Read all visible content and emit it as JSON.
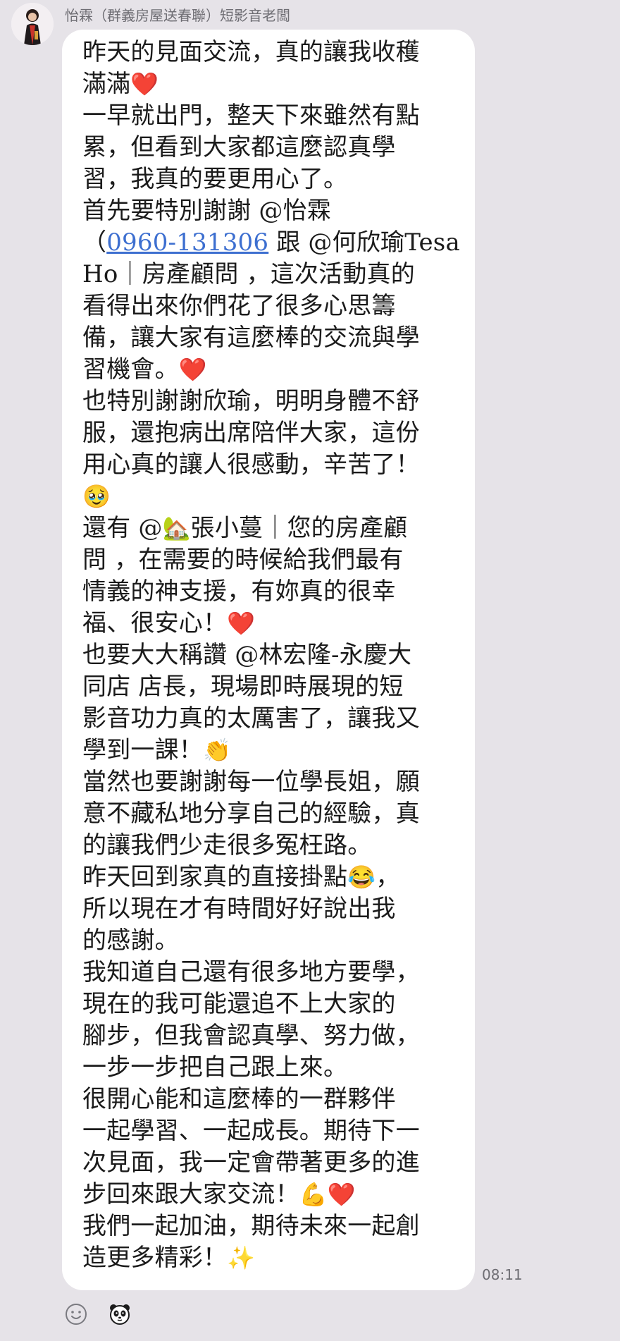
{
  "sender": {
    "name": "怡霖（群義房屋送春聯）短影音老闆"
  },
  "message": {
    "lines": [
      [
        "昨天的見面交流，真的讓我收穫"
      ],
      [
        "滿滿",
        "❤️"
      ],
      [
        "一早就出門，整天下來雖然有點"
      ],
      [
        "累，但看到大家都這麼認真學"
      ],
      [
        "習，我真的要更用心了。"
      ],
      [
        "首先要特別謝謝 @怡霖"
      ],
      [
        "（",
        "0960-131306",
        " 跟 @何欣瑜Tesa"
      ],
      [
        "Ho｜房產顧問 ，這次活動真的"
      ],
      [
        "看得出來你們花了很多心思籌"
      ],
      [
        "備，讓大家有這麼棒的交流與學"
      ],
      [
        "習機會。",
        "❤️"
      ],
      [
        "也特別謝謝欣瑜，明明身體不舒"
      ],
      [
        "服，還抱病出席陪伴大家，這份"
      ],
      [
        "用心真的讓人很感動，辛苦了！"
      ],
      [
        "",
        "🥹"
      ],
      [
        "還有 @",
        "🏡",
        "張小蔓｜您的房產顧"
      ],
      [
        "問 ，在需要的時候給我們最有"
      ],
      [
        "情義的神支援，有妳真的很幸"
      ],
      [
        "福、很安心！",
        "❤️"
      ],
      [
        "也要大大稱讚 @林宏隆-永慶大"
      ],
      [
        "同店 店長，現場即時展現的短"
      ],
      [
        "影音功力真的太厲害了，讓我又"
      ],
      [
        "學到一課！",
        "👏"
      ],
      [
        "當然也要謝謝每一位學長姐，願"
      ],
      [
        "意不藏私地分享自己的經驗，真"
      ],
      [
        "的讓我們少走很多冤枉路。"
      ],
      [
        "昨天回到家真的直接掛點",
        "😂",
        "，"
      ],
      [
        "所以現在才有時間好好說出我"
      ],
      [
        "的感謝。"
      ],
      [
        "我知道自己還有很多地方要學，"
      ],
      [
        "現在的我可能還追不上大家的"
      ],
      [
        "腳步，但我會認真學、努力做，"
      ],
      [
        "一步一步把自己跟上來。"
      ],
      [
        "很開心能和這麼棒的一群夥伴"
      ],
      [
        "一起學習、一起成長。期待下一"
      ],
      [
        "次見面，我一定會帶著更多的進"
      ],
      [
        "步回來跟大家交流！",
        "💪❤️"
      ],
      [
        "我們一起加油，期待未來一起創"
      ],
      [
        "造更多精彩！",
        "✨"
      ]
    ],
    "time": "08:11"
  },
  "reactions": [
    {
      "icon": "smiley-react-icon"
    },
    {
      "icon": "panda-sticker-icon"
    }
  ]
}
